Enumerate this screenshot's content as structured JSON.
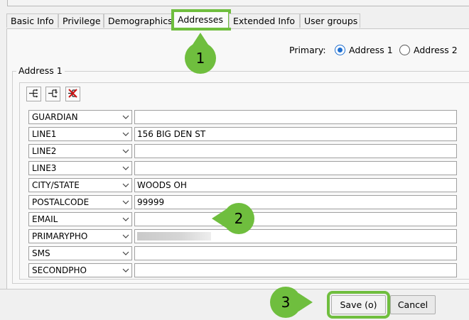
{
  "tabs": [
    {
      "label": "Basic Info",
      "active": false
    },
    {
      "label": "Privilege",
      "active": false
    },
    {
      "label": "Demographics",
      "active": false
    },
    {
      "label": "Addresses",
      "active": true
    },
    {
      "label": "Extended Info",
      "active": false
    },
    {
      "label": "User groups",
      "active": false
    }
  ],
  "primary": {
    "label": "Primary:",
    "options": [
      {
        "label": "Address 1",
        "selected": true
      },
      {
        "label": "Address 2",
        "selected": false
      }
    ]
  },
  "address_group": {
    "legend": "Address 1",
    "toolbar": [
      "add-line-icon",
      "insert-line-icon",
      "delete-line-icon"
    ],
    "rows": [
      {
        "field": "GUARDIAN",
        "value": ""
      },
      {
        "field": "LINE1",
        "value": "156 BIG DEN ST"
      },
      {
        "field": "LINE2",
        "value": ""
      },
      {
        "field": "LINE3",
        "value": ""
      },
      {
        "field": "CITY/STATE",
        "value": "WOODS OH"
      },
      {
        "field": "POSTALCODE",
        "value": "99999"
      },
      {
        "field": "EMAIL",
        "value": ""
      },
      {
        "field": "PRIMARYPHO",
        "value": "",
        "redacted": true
      },
      {
        "field": "SMS",
        "value": ""
      },
      {
        "field": "SECONDPHO",
        "value": ""
      }
    ]
  },
  "buttons": {
    "save": "Save (o)",
    "cancel": "Cancel"
  },
  "callouts": [
    "1",
    "2",
    "3"
  ],
  "colors": {
    "highlight": "#6fbe3e",
    "radio_selected": "#1f6fd0",
    "delete_icon": "#d01010"
  }
}
